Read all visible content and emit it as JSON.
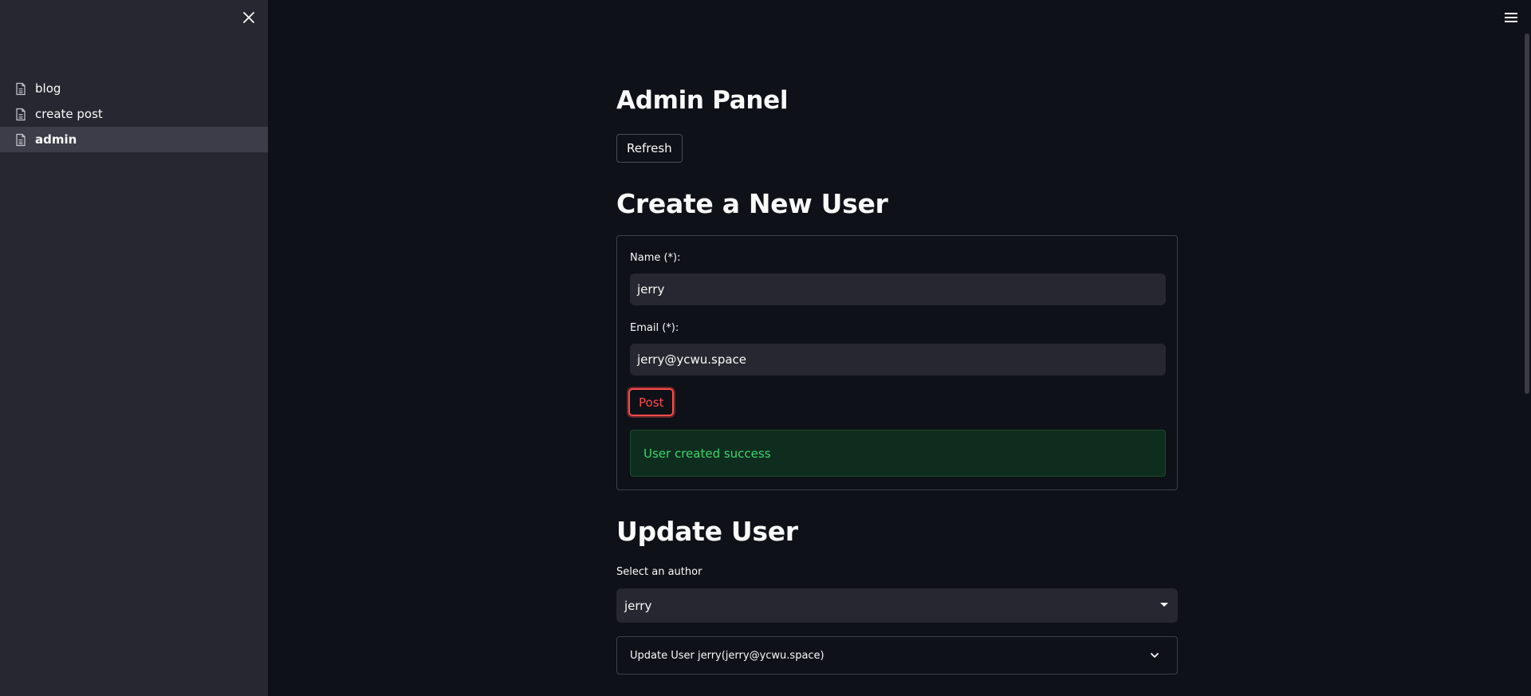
{
  "sidebar": {
    "items": [
      {
        "label": "blog",
        "icon": "document-icon"
      },
      {
        "label": "create post",
        "icon": "document-icon"
      },
      {
        "label": "admin",
        "icon": "document-icon",
        "active": true
      }
    ]
  },
  "main": {
    "title": "Admin Panel",
    "refresh_label": "Refresh",
    "create_section": {
      "title": "Create a New User",
      "name_label": "Name (*):",
      "name_value": "jerry",
      "email_label": "Email (*):",
      "email_value": "jerry@ycwu.space",
      "post_label": "Post",
      "success_message": "User created success"
    },
    "update_section": {
      "title": "Update User",
      "select_label": "Select an author",
      "select_value": "jerry",
      "expander_label": "Update User jerry(jerry@ycwu.space)"
    }
  },
  "colors": {
    "background": "#0e1117",
    "sidebar": "#262730",
    "accent": "#ff4b4b",
    "success_text": "#3dd56d",
    "success_bg": "#0f2d1f"
  }
}
